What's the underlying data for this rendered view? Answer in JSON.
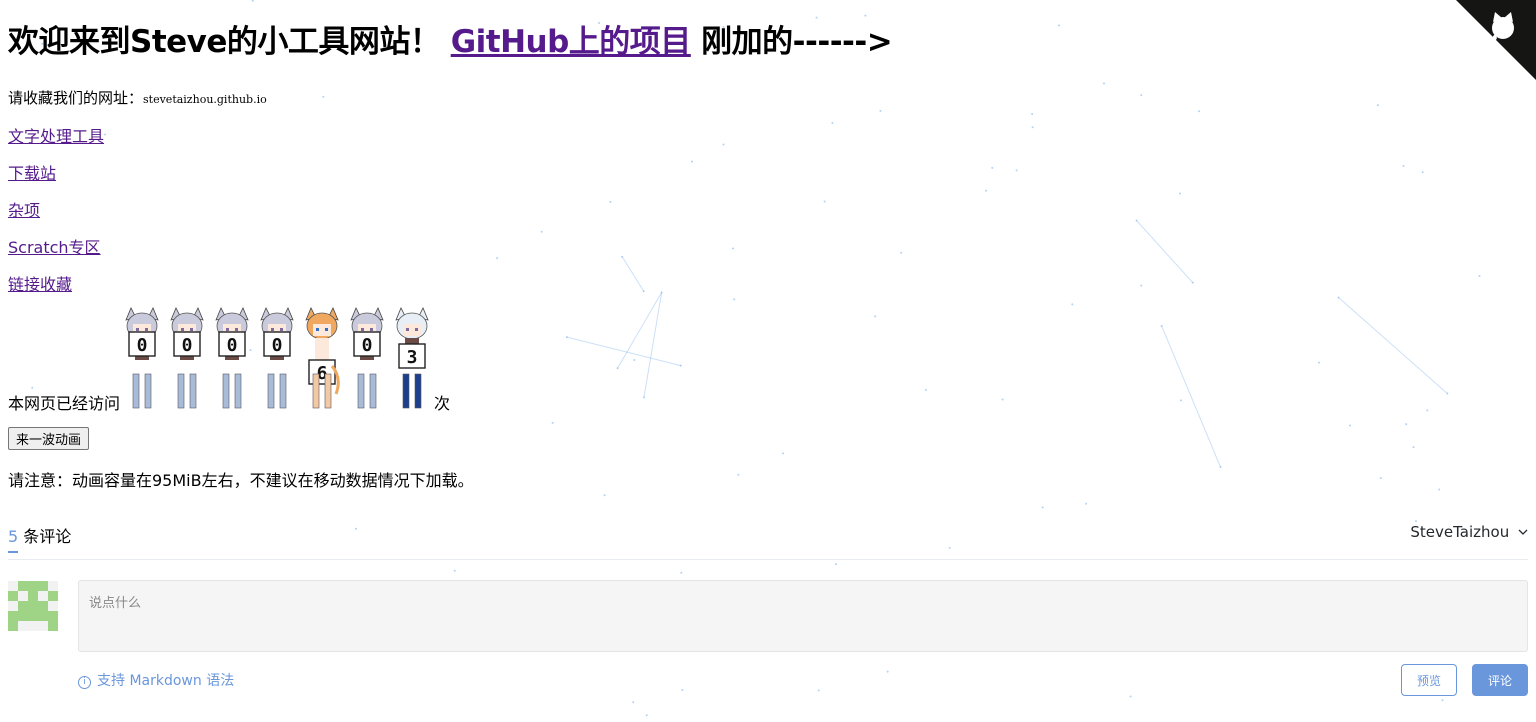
{
  "header": {
    "title_prefix": "欢迎来到Steve的小工具网站！",
    "github_link": "GitHub上的项目",
    "title_suffix": "刚加的------>"
  },
  "bookmark": {
    "label": "请收藏我们的网址：",
    "url": "stevetaizhou.github.io"
  },
  "nav_links": [
    "文字处理工具",
    "下载站",
    "杂项",
    "Scratch专区",
    "链接收藏"
  ],
  "counter": {
    "prefix": "本网页已经访问",
    "digits": [
      "0",
      "0",
      "0",
      "0",
      "6",
      "0",
      "3"
    ],
    "suffix": "次"
  },
  "animation_button": "来一波动画",
  "notice": "请注意：动画容量在95MiB左右，不建议在移动数据情况下加载。",
  "comments": {
    "count": "5",
    "count_label": "条评论",
    "user": "SteveTaizhou",
    "user_dropdown_icon": "chevron-down-icon",
    "placeholder": "说点什么",
    "markdown_hint": "支持 Markdown 语法",
    "preview_label": "预览",
    "submit_label": "评论"
  },
  "icons": {
    "corner": "github-octocat-icon",
    "info": "info-icon"
  },
  "colors": {
    "link": "#551a8b",
    "accent": "#6a97dc",
    "avatar": "#9fd486",
    "corner_bg": "#151513"
  }
}
